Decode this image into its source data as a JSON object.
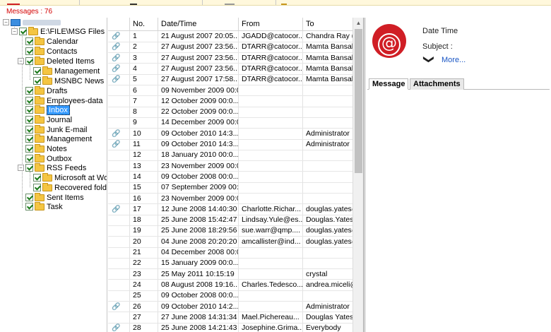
{
  "status": {
    "message_count": "Messages : 76"
  },
  "tree": {
    "root_label": "",
    "file_node": "E:\\FILE\\MSG Files",
    "folders": [
      {
        "label": "Calendar"
      },
      {
        "label": "Contacts"
      },
      {
        "label": "Deleted Items"
      },
      {
        "label": "Management"
      },
      {
        "label": "MSNBC News"
      },
      {
        "label": "Drafts"
      },
      {
        "label": "Employees-data"
      },
      {
        "label": "Inbox"
      },
      {
        "label": "Journal"
      },
      {
        "label": "Junk E-mail"
      },
      {
        "label": "Management"
      },
      {
        "label": "Notes"
      },
      {
        "label": "Outbox"
      },
      {
        "label": "RSS Feeds"
      },
      {
        "label": "Microsoft at Work"
      },
      {
        "label": "Recovered folder"
      },
      {
        "label": "Sent Items"
      },
      {
        "label": "Task"
      }
    ],
    "selected": "Inbox",
    "expander_collapse": "−",
    "folder_color": "#f4c542",
    "selected_color": "#3399ff"
  },
  "list": {
    "columns": [
      "No.",
      "Date/Time",
      "From",
      "To"
    ],
    "attachment_glyph": "🔗",
    "rows": [
      {
        "att": true,
        "no": "1",
        "date": "21 August 2007 20:05...",
        "from": "JGADD@catocor...",
        "to": "Chandra Ray (E..."
      },
      {
        "att": true,
        "no": "2",
        "date": "27 August 2007 23:56...",
        "from": "DTARR@catocor...",
        "to": "Mamta Bansal (..."
      },
      {
        "att": true,
        "no": "3",
        "date": "27 August 2007 23:56...",
        "from": "DTARR@catocor...",
        "to": "Mamta Bansal (..."
      },
      {
        "att": true,
        "no": "4",
        "date": "27 August 2007 23:56...",
        "from": "DTARR@catocor...",
        "to": "Mamta Bansal (..."
      },
      {
        "att": true,
        "no": "5",
        "date": "27 August 2007 17:58...",
        "from": "DTARR@catocor...",
        "to": "Mamta Bansal (..."
      },
      {
        "att": false,
        "no": "6",
        "date": "09 November 2009 00:0...",
        "from": "",
        "to": ""
      },
      {
        "att": false,
        "no": "7",
        "date": "12 October 2009 00:0...",
        "from": "",
        "to": ""
      },
      {
        "att": false,
        "no": "8",
        "date": "22 October 2009 00:0...",
        "from": "",
        "to": ""
      },
      {
        "att": false,
        "no": "9",
        "date": "14 December 2009 00:0...",
        "from": "",
        "to": ""
      },
      {
        "att": true,
        "no": "10",
        "date": "09 October 2010 14:3...",
        "from": "",
        "to": "Administrator"
      },
      {
        "att": true,
        "no": "11",
        "date": "09 October 2010 14:3...",
        "from": "",
        "to": "Administrator"
      },
      {
        "att": false,
        "no": "12",
        "date": "18 January 2010 00:0...",
        "from": "",
        "to": ""
      },
      {
        "att": false,
        "no": "13",
        "date": "23 November 2009 00:0...",
        "from": "",
        "to": ""
      },
      {
        "att": false,
        "no": "14",
        "date": "09 October 2008 00:0...",
        "from": "",
        "to": ""
      },
      {
        "att": false,
        "no": "15",
        "date": "07 September 2009 00:0...",
        "from": "",
        "to": ""
      },
      {
        "att": false,
        "no": "16",
        "date": "23 November 2009 00:0...",
        "from": "",
        "to": ""
      },
      {
        "att": true,
        "no": "17",
        "date": "12 June 2008 14:40:30",
        "from": "Charlotte.Richar...",
        "to": "douglas.yates@..."
      },
      {
        "att": false,
        "no": "18",
        "date": "25 June 2008 15:42:47",
        "from": "Lindsay.Yule@es...",
        "to": "Douglas.Yates@..."
      },
      {
        "att": false,
        "no": "19",
        "date": "25 June 2008 18:29:56",
        "from": "sue.warr@qmp....",
        "to": "douglas.yates@..."
      },
      {
        "att": false,
        "no": "20",
        "date": "04 June 2008 20:20:20",
        "from": "amcallister@ind...",
        "to": "douglas.yates@..."
      },
      {
        "att": false,
        "no": "21",
        "date": "04 December 2008 00:0...",
        "from": "",
        "to": ""
      },
      {
        "att": false,
        "no": "22",
        "date": "15 January 2009 00:0...",
        "from": "",
        "to": ""
      },
      {
        "att": false,
        "no": "23",
        "date": "25 May 2011 10:15:19",
        "from": "",
        "to": "crystal"
      },
      {
        "att": false,
        "no": "24",
        "date": "08 August 2008 19:16...",
        "from": "Charles.Tedesco...",
        "to": "andrea.miceli@..."
      },
      {
        "att": false,
        "no": "25",
        "date": "09 October 2008 00:0...",
        "from": "",
        "to": ""
      },
      {
        "att": true,
        "no": "26",
        "date": "09 October 2010 14:2...",
        "from": "",
        "to": "Administrator"
      },
      {
        "att": false,
        "no": "27",
        "date": "27 June 2008 14:31:34",
        "from": "Mael.Pichereau...",
        "to": "Douglas Yates"
      },
      {
        "att": true,
        "no": "28",
        "date": "25 June 2008 14:21:43",
        "from": "Josephine.Grima...",
        "to": "Everybody"
      }
    ]
  },
  "preview": {
    "avatar_glyph": "@",
    "date_time_label": "Date Time",
    "subject_label": "Subject :",
    "more_label": "More...",
    "chevron_glyph": "❯",
    "tabs": [
      "Message",
      "Attachments"
    ],
    "avatar_color": "#d01e25",
    "link_color": "#1a56c4"
  },
  "scrollbar": {
    "up_glyph": "▲"
  }
}
